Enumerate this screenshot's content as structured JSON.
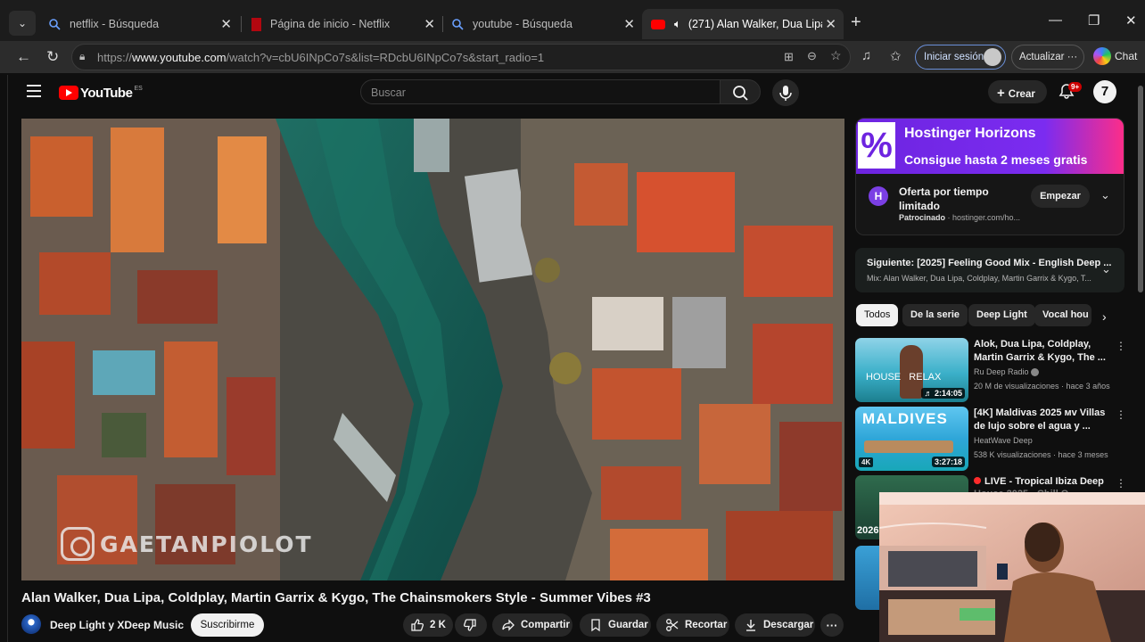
{
  "browser": {
    "tabs": [
      {
        "label": "netflix - Búsqueda",
        "icon": "search-favicon"
      },
      {
        "label": "Página de inicio - Netflix",
        "icon": "netflix-favicon"
      },
      {
        "label": "youtube - Búsqueda",
        "icon": "search-favicon"
      },
      {
        "label": "(271) Alan Walker, Dua Lipa, C",
        "icon": "youtube-favicon",
        "active": true
      }
    ],
    "url_prefix": "https://",
    "url_host": "www.youtube.com",
    "url_path": "/watch?v=cbU6INpCo7s&list=RDcbU6INpCo7s&start_radio=1",
    "signin_label": "Iniciar sesión",
    "update_label": "Actualizar",
    "update_more": "···",
    "chat_label": "Chat"
  },
  "youtube": {
    "logo_text": "YouTube",
    "country_code": "ES",
    "search_placeholder": "Buscar",
    "create_label": "Crear",
    "notification_count": "9+",
    "video": {
      "watermark": "GAETANPIOLOT",
      "title": "Alan Walker, Dua Lipa, Coldplay, Martin Garrix & Kygo, The Chainsmokers Style - Summer Vibes #3",
      "channel": "Deep Light y XDeep Music",
      "subscribe_label": "Suscribirme",
      "likes": "2 K",
      "share_label": "Compartir",
      "save_label": "Guardar",
      "clip_label": "Recortar",
      "download_label": "Descargar"
    },
    "ad": {
      "banner_title": "Hostinger Horizons",
      "banner_sub": "Consigue hasta 2 meses gratis",
      "percent_glyph": "%",
      "title": "Oferta por tiempo limitado",
      "sponsored": "Patrocinado",
      "domain": " · hostinger.com/ho...",
      "cta": "Empezar",
      "brand_color": "#6d24e0"
    },
    "next_mix": {
      "title": "Siguiente: [2025] Feeling Good Mix - English Deep ...",
      "subtitle": "Mix: Alan Walker, Dua Lipa, Coldplay, Martin Garrix & Kygo, T..."
    },
    "chips": [
      "Todos",
      "De la serie",
      "Deep Light",
      "Vocal hou"
    ],
    "recommendations": [
      {
        "title": "Alok, Dua Lipa, Coldplay, Martin Garrix & Kygo, The ...",
        "channel": "Ru Deep Radio",
        "meta": "20 M de visualizaciones · hace 3 años",
        "duration": "2:14:05",
        "thumb_text": "HOUSE   RELAX"
      },
      {
        "title": "[4K] Maldivas 2025 ᴍᴠ Villas de lujo sobre el agua y ...",
        "channel": "HeatWave Deep",
        "meta": "538 K visualizaciones · hace 3 meses",
        "duration": "3:27:18",
        "thumb_text": "MALDIVES",
        "badge": "4K"
      },
      {
        "title": "LIVE - Tropical Ibiza Deep",
        "live": true,
        "partial_title": "House 2025 · Chill O..."
      }
    ],
    "partial_year": "2026"
  }
}
